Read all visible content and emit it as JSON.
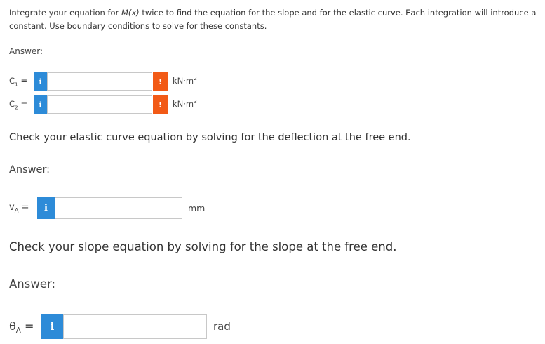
{
  "instructions": {
    "part1": "Integrate your equation for ",
    "mx": "M(x)",
    "part2": " twice to find the equation for the slope and for the elastic curve. Each integration will introduce a constant. Use boundary conditions to solve for these constants."
  },
  "section1": {
    "answer_label": "Answer:",
    "c1": {
      "symbol": "C",
      "sub": "1",
      "eq": " =",
      "info": "i",
      "value": "",
      "warn": "!",
      "unit": "kN·m",
      "unit_sup": "2"
    },
    "c2": {
      "symbol": "C",
      "sub": "2",
      "eq": " =",
      "info": "i",
      "value": "",
      "warn": "!",
      "unit": "kN·m",
      "unit_sup": "3"
    }
  },
  "section2": {
    "prompt": "Check your elastic curve equation by solving for the deflection at the free end.",
    "answer_label": "Answer:",
    "va": {
      "symbol": "v",
      "sub": "A",
      "eq": " =",
      "info": "i",
      "value": "",
      "unit": "mm"
    }
  },
  "section3": {
    "prompt": "Check your slope equation by solving for the slope at the free end.",
    "answer_label": "Answer:",
    "theta": {
      "symbol": "θ",
      "sub": "A",
      "eq": " =",
      "info": "i",
      "value": "",
      "unit": "rad"
    }
  },
  "colors": {
    "info_button": "#2d8bd8",
    "warning_button": "#f25a16",
    "input_border": "#c8c8c8",
    "text": "#333333"
  }
}
